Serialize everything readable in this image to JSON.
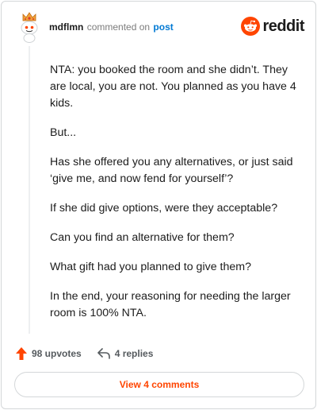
{
  "comment": {
    "username": "mdflmn",
    "action_text": "commented on",
    "target_link": "post",
    "paragraphs": [
      "NTA: you booked the room and she didn’t. They are local, you are not. You planned as you have 4 kids.",
      "But...",
      "Has she offered you any alternatives, or just said ‘give me, and now fend for yourself’?",
      "If she did give options, were they acceptable?",
      "Can you find an alternative for them?",
      "What gift had you planned to give them?",
      "In the end, your reasoning for needing the larger room is 100% NTA."
    ]
  },
  "brand": {
    "wordmark": "reddit",
    "icon": "reddit-snoo-icon",
    "color": "#ff4500"
  },
  "actions": {
    "upvotes_label": "98 upvotes",
    "upvote_icon": "upvote-arrow-icon",
    "replies_label": "4 replies",
    "reply_icon": "reply-arrow-icon"
  },
  "view_comments_label": "View 4 comments",
  "colors": {
    "accent": "#ff4500",
    "link": "#0079d3",
    "muted": "#7c7c7c"
  }
}
